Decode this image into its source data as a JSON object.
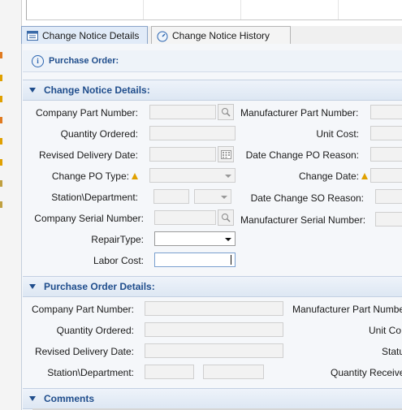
{
  "tabs": [
    {
      "label": "Change Notice Details",
      "icon": "details-icon",
      "active": true
    },
    {
      "label": "Change Notice History",
      "icon": "history-icon",
      "active": false
    }
  ],
  "info": {
    "label": "Purchase Order:",
    "icon": "info-icon"
  },
  "change_notice": {
    "title": "Change Notice Details:",
    "company_part_number": "Company Part Number:",
    "manufacturer_part_number": "Manufacturer Part Number:",
    "quantity_ordered": "Quantity Ordered:",
    "unit_cost": "Unit Cost:",
    "revised_delivery_date": "Revised Delivery Date:",
    "date_change_po_reason": "Date Change PO Reason:",
    "change_po_type": "Change PO Type:",
    "change_date": "Change Date:",
    "station_department": "Station\\Department:",
    "date_change_so_reason": "Date Change SO Reason:",
    "company_serial_number": "Company Serial Number:",
    "manufacturer_serial_number": "Manufacturer Serial Number:",
    "repair_type": "RepairType:",
    "labor_cost": "Labor Cost:"
  },
  "purchase_order": {
    "title": "Purchase Order Details:",
    "company_part_number": "Company Part Number:",
    "manufacturer_part_number": "Manufacturer Part Numbe",
    "quantity_ordered": "Quantity Ordered:",
    "unit_cost": "Unit Co",
    "revised_delivery_date": "Revised Delivery Date:",
    "status": "Statu",
    "station_department": "Station\\Department:",
    "quantity_received": "Quantity Receive"
  },
  "comments": {
    "title": "Comments"
  },
  "colors": {
    "accent": "#1f4d8c",
    "warning": "#e0a000",
    "tab_active": "#e1ebf8"
  }
}
